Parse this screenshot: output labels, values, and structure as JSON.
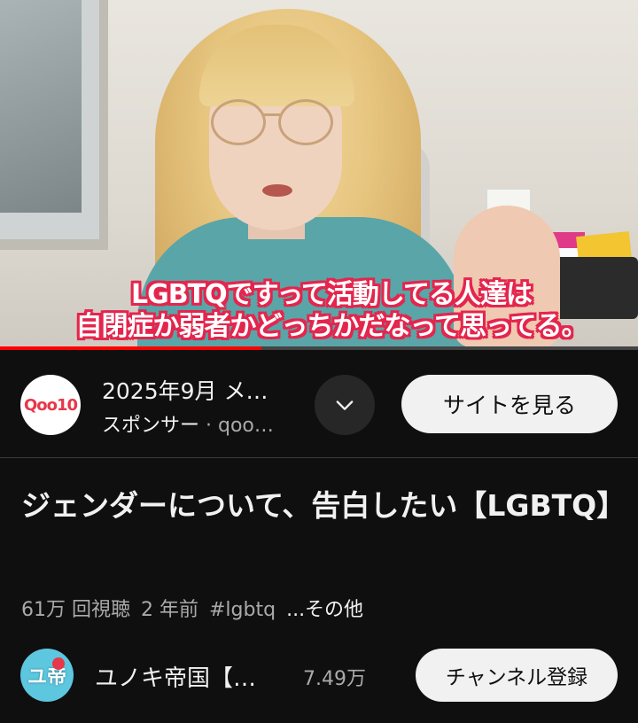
{
  "video": {
    "caption_line1": "LGBTQですって活動してる人達は",
    "caption_line2": "自閉症か弱者かどっちかだなって思ってる。",
    "progress_fraction": 0.41
  },
  "ad": {
    "logo_text": "Qoo10",
    "title": "2025年9月 メ…",
    "sponsor_label": "スポンサー",
    "separator": " · ",
    "advertiser": "qoo…",
    "cta_label": "サイトを見る"
  },
  "video_info": {
    "title": "ジェンダーについて、告白したい【LGBTQ】",
    "views": "61万 回視聴",
    "age": "2 年前",
    "hashtag": "#lgbtq",
    "more_label": "...その他"
  },
  "channel": {
    "avatar_text": "ユ帝",
    "name": "ユノキ帝国【…",
    "subscribers": "7.49万",
    "subscribe_label": "チャンネル登録"
  },
  "colors": {
    "background": "#0f0f0f",
    "caption_outline": "#e4254d",
    "progress": "#ff0000",
    "button_light": "#f1f1f1"
  }
}
